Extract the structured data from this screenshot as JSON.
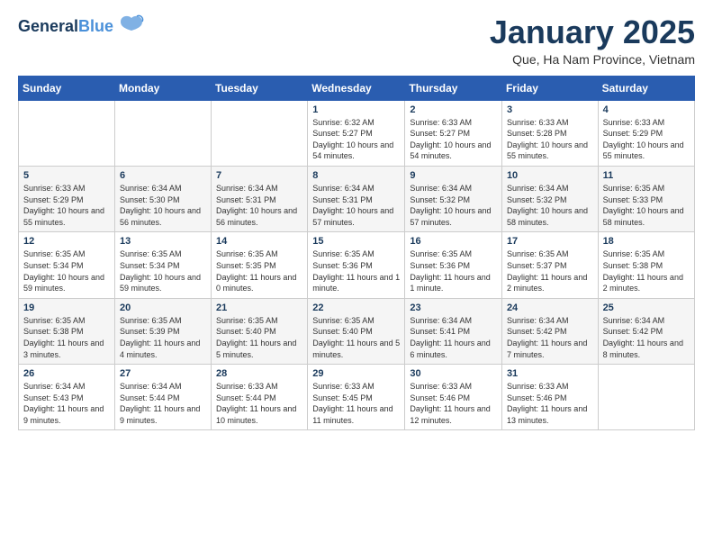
{
  "header": {
    "logo_general": "General",
    "logo_blue": "Blue",
    "main_title": "January 2025",
    "subtitle": "Que, Ha Nam Province, Vietnam"
  },
  "weekdays": [
    "Sunday",
    "Monday",
    "Tuesday",
    "Wednesday",
    "Thursday",
    "Friday",
    "Saturday"
  ],
  "rows": [
    [
      {
        "day": "",
        "info": ""
      },
      {
        "day": "",
        "info": ""
      },
      {
        "day": "",
        "info": ""
      },
      {
        "day": "1",
        "info": "Sunrise: 6:32 AM\nSunset: 5:27 PM\nDaylight: 10 hours\nand 54 minutes."
      },
      {
        "day": "2",
        "info": "Sunrise: 6:33 AM\nSunset: 5:27 PM\nDaylight: 10 hours\nand 54 minutes."
      },
      {
        "day": "3",
        "info": "Sunrise: 6:33 AM\nSunset: 5:28 PM\nDaylight: 10 hours\nand 55 minutes."
      },
      {
        "day": "4",
        "info": "Sunrise: 6:33 AM\nSunset: 5:29 PM\nDaylight: 10 hours\nand 55 minutes."
      }
    ],
    [
      {
        "day": "5",
        "info": "Sunrise: 6:33 AM\nSunset: 5:29 PM\nDaylight: 10 hours\nand 55 minutes."
      },
      {
        "day": "6",
        "info": "Sunrise: 6:34 AM\nSunset: 5:30 PM\nDaylight: 10 hours\nand 56 minutes."
      },
      {
        "day": "7",
        "info": "Sunrise: 6:34 AM\nSunset: 5:31 PM\nDaylight: 10 hours\nand 56 minutes."
      },
      {
        "day": "8",
        "info": "Sunrise: 6:34 AM\nSunset: 5:31 PM\nDaylight: 10 hours\nand 57 minutes."
      },
      {
        "day": "9",
        "info": "Sunrise: 6:34 AM\nSunset: 5:32 PM\nDaylight: 10 hours\nand 57 minutes."
      },
      {
        "day": "10",
        "info": "Sunrise: 6:34 AM\nSunset: 5:32 PM\nDaylight: 10 hours\nand 58 minutes."
      },
      {
        "day": "11",
        "info": "Sunrise: 6:35 AM\nSunset: 5:33 PM\nDaylight: 10 hours\nand 58 minutes."
      }
    ],
    [
      {
        "day": "12",
        "info": "Sunrise: 6:35 AM\nSunset: 5:34 PM\nDaylight: 10 hours\nand 59 minutes."
      },
      {
        "day": "13",
        "info": "Sunrise: 6:35 AM\nSunset: 5:34 PM\nDaylight: 10 hours\nand 59 minutes."
      },
      {
        "day": "14",
        "info": "Sunrise: 6:35 AM\nSunset: 5:35 PM\nDaylight: 11 hours\nand 0 minutes."
      },
      {
        "day": "15",
        "info": "Sunrise: 6:35 AM\nSunset: 5:36 PM\nDaylight: 11 hours\nand 1 minute."
      },
      {
        "day": "16",
        "info": "Sunrise: 6:35 AM\nSunset: 5:36 PM\nDaylight: 11 hours\nand 1 minute."
      },
      {
        "day": "17",
        "info": "Sunrise: 6:35 AM\nSunset: 5:37 PM\nDaylight: 11 hours\nand 2 minutes."
      },
      {
        "day": "18",
        "info": "Sunrise: 6:35 AM\nSunset: 5:38 PM\nDaylight: 11 hours\nand 2 minutes."
      }
    ],
    [
      {
        "day": "19",
        "info": "Sunrise: 6:35 AM\nSunset: 5:38 PM\nDaylight: 11 hours\nand 3 minutes."
      },
      {
        "day": "20",
        "info": "Sunrise: 6:35 AM\nSunset: 5:39 PM\nDaylight: 11 hours\nand 4 minutes."
      },
      {
        "day": "21",
        "info": "Sunrise: 6:35 AM\nSunset: 5:40 PM\nDaylight: 11 hours\nand 5 minutes."
      },
      {
        "day": "22",
        "info": "Sunrise: 6:35 AM\nSunset: 5:40 PM\nDaylight: 11 hours\nand 5 minutes."
      },
      {
        "day": "23",
        "info": "Sunrise: 6:34 AM\nSunset: 5:41 PM\nDaylight: 11 hours\nand 6 minutes."
      },
      {
        "day": "24",
        "info": "Sunrise: 6:34 AM\nSunset: 5:42 PM\nDaylight: 11 hours\nand 7 minutes."
      },
      {
        "day": "25",
        "info": "Sunrise: 6:34 AM\nSunset: 5:42 PM\nDaylight: 11 hours\nand 8 minutes."
      }
    ],
    [
      {
        "day": "26",
        "info": "Sunrise: 6:34 AM\nSunset: 5:43 PM\nDaylight: 11 hours\nand 9 minutes."
      },
      {
        "day": "27",
        "info": "Sunrise: 6:34 AM\nSunset: 5:44 PM\nDaylight: 11 hours\nand 9 minutes."
      },
      {
        "day": "28",
        "info": "Sunrise: 6:33 AM\nSunset: 5:44 PM\nDaylight: 11 hours\nand 10 minutes."
      },
      {
        "day": "29",
        "info": "Sunrise: 6:33 AM\nSunset: 5:45 PM\nDaylight: 11 hours\nand 11 minutes."
      },
      {
        "day": "30",
        "info": "Sunrise: 6:33 AM\nSunset: 5:46 PM\nDaylight: 11 hours\nand 12 minutes."
      },
      {
        "day": "31",
        "info": "Sunrise: 6:33 AM\nSunset: 5:46 PM\nDaylight: 11 hours\nand 13 minutes."
      },
      {
        "day": "",
        "info": ""
      }
    ]
  ]
}
